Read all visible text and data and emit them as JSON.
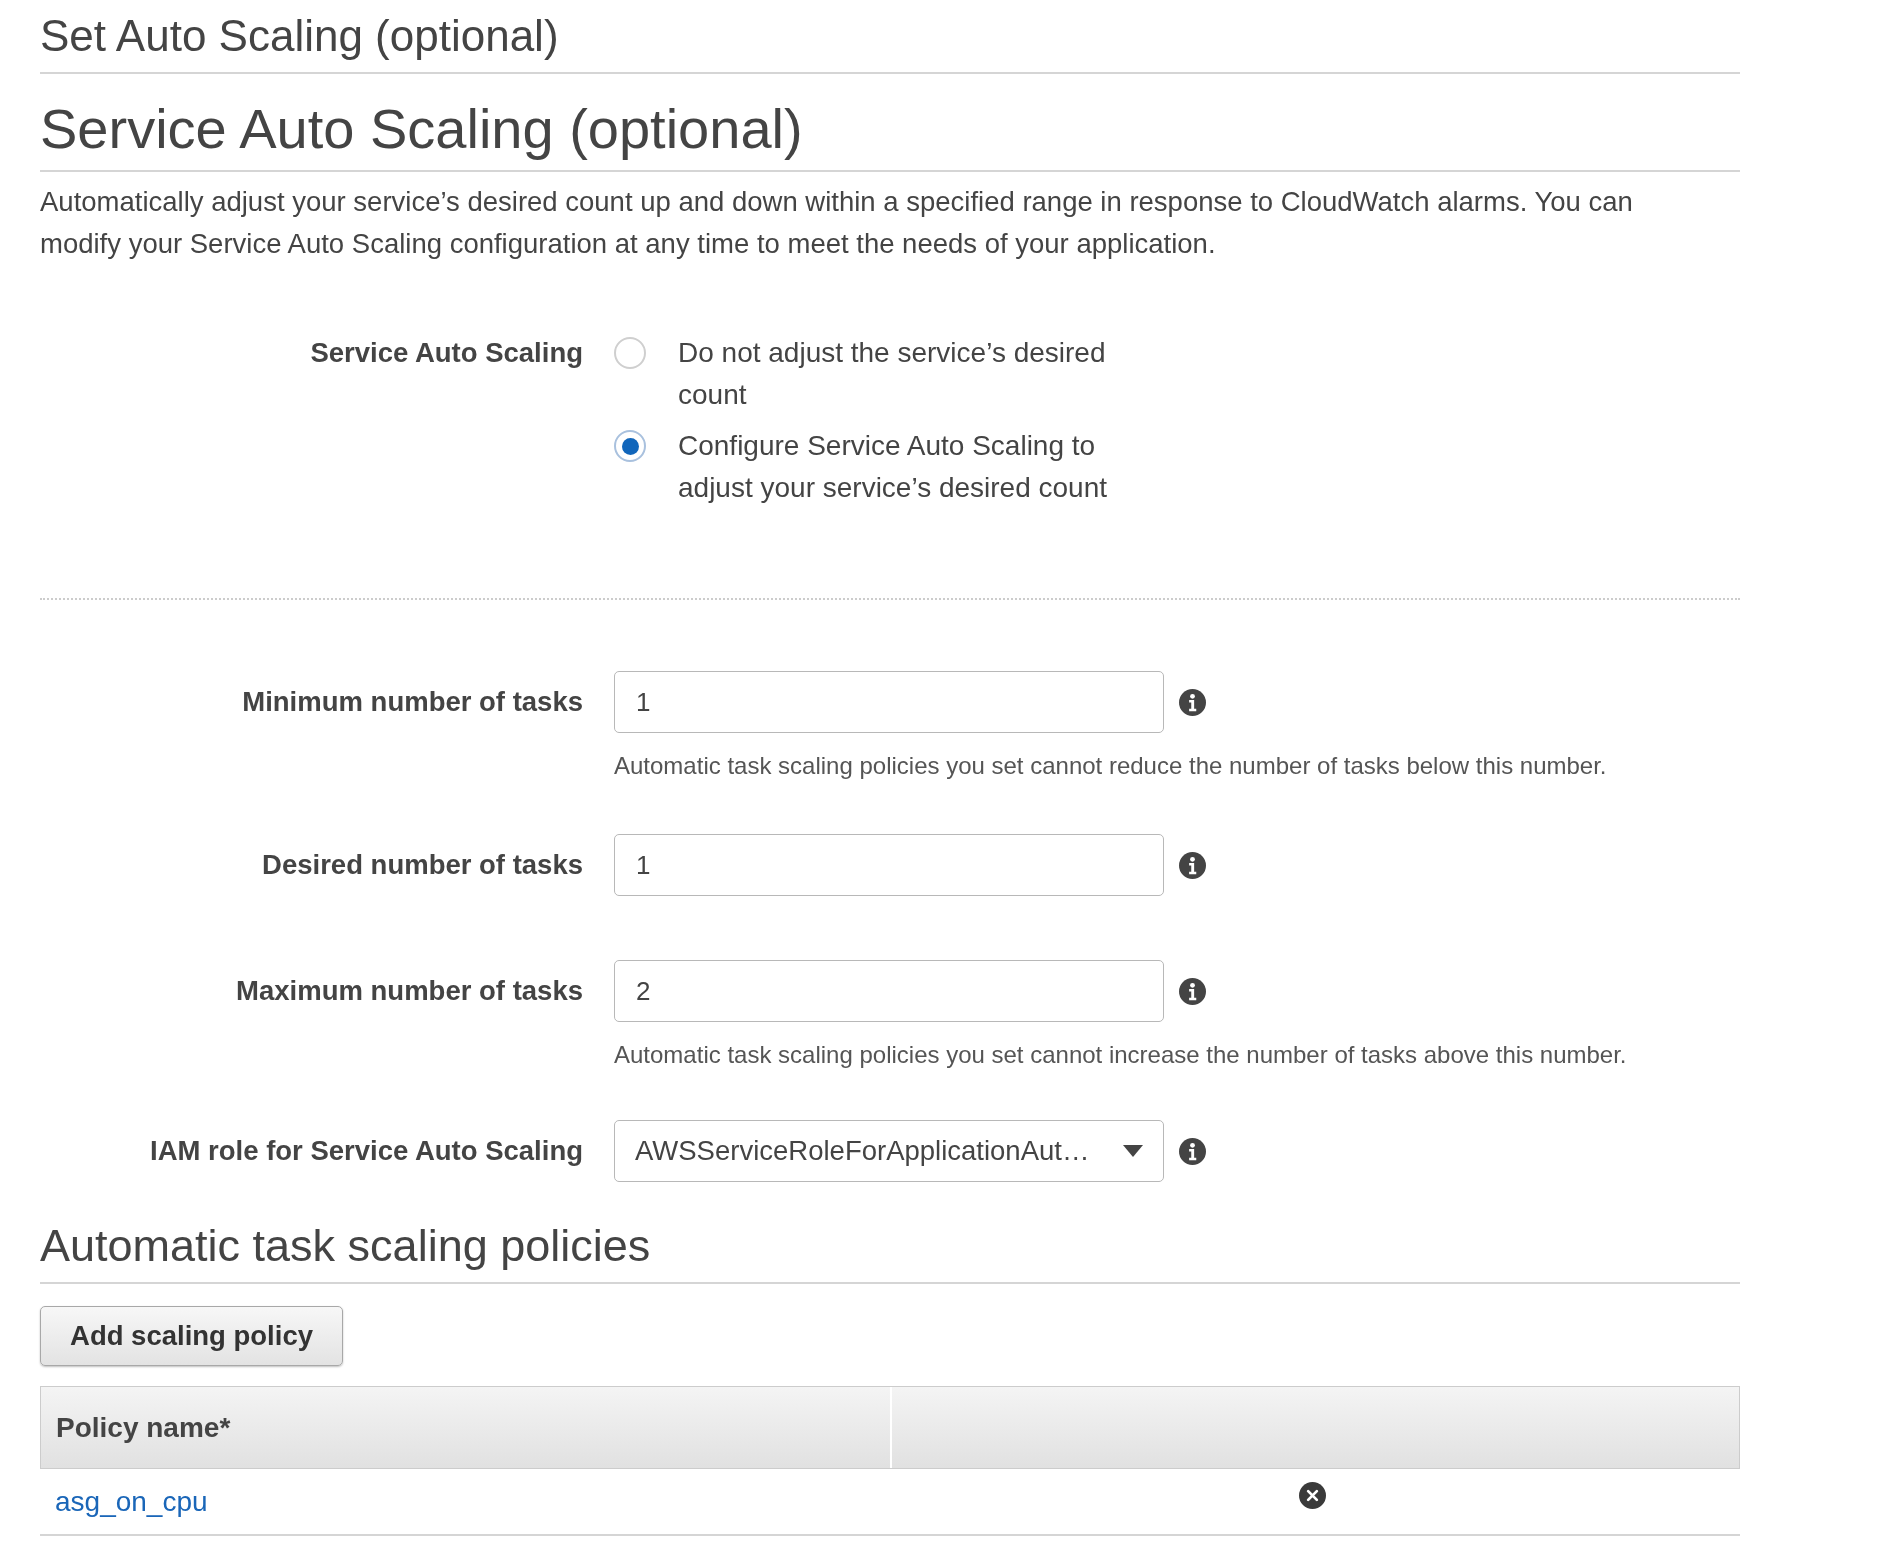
{
  "section_title": "Set Auto Scaling (optional)",
  "heading": "Service Auto Scaling (optional)",
  "description": "Automatically adjust your service’s desired count up and down within a specified range in response to CloudWatch alarms. You can modify your Service Auto Scaling configuration at any time to meet the needs of your application.",
  "service_auto_scaling": {
    "label": "Service Auto Scaling",
    "options": [
      {
        "label": "Do not adjust the service’s desired count",
        "selected": false
      },
      {
        "label": "Configure Service Auto Scaling to adjust your service’s desired count",
        "selected": true
      }
    ]
  },
  "fields": [
    {
      "kind": "input",
      "label": "Minimum number of tasks",
      "value": "1",
      "help": "Automatic task scaling policies you set cannot reduce the number of tasks below this number."
    },
    {
      "kind": "input",
      "label": "Desired number of tasks",
      "value": "1"
    },
    {
      "kind": "input",
      "label": "Maximum number of tasks",
      "value": "2",
      "help": "Automatic task scaling policies you set cannot increase the number of tasks above this number."
    },
    {
      "kind": "select",
      "label": "IAM role for Service Auto Scaling",
      "value": "AWSServiceRoleForApplicationAut…"
    }
  ],
  "policies": {
    "title": "Automatic task scaling policies",
    "add_button": "Add scaling policy",
    "table": {
      "columns": [
        "Policy name*"
      ],
      "rows": [
        {
          "policy_name": "asg_on_cpu"
        }
      ]
    }
  }
}
